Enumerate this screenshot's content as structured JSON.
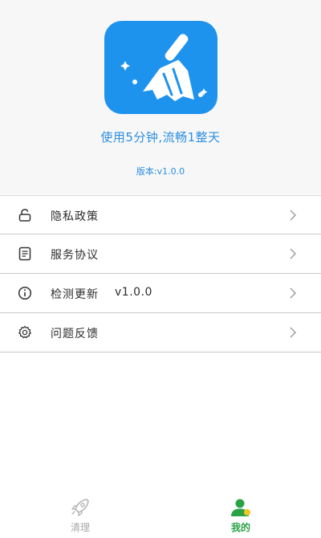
{
  "header": {
    "slogan": "使用5分钟,流畅1整天",
    "version": "版本:v1.0.0"
  },
  "menu": {
    "items": [
      {
        "label": "隐私政策",
        "icon": "lock-icon"
      },
      {
        "label": "服务协议",
        "icon": "document-icon"
      },
      {
        "label": "检测更新",
        "icon": "info-icon",
        "version": "v1.0.0"
      },
      {
        "label": "问题反馈",
        "icon": "gear-icon"
      }
    ]
  },
  "bottom_nav": {
    "tabs": [
      {
        "label": "清理",
        "icon": "rocket-icon",
        "active": false
      },
      {
        "label": "我的",
        "icon": "user-icon",
        "active": true
      }
    ]
  },
  "colors": {
    "accent_blue": "#1e93ee",
    "text_blue": "#2c8fe0",
    "active_green": "#2aa347",
    "inactive_gray": "#a8a8a8"
  }
}
